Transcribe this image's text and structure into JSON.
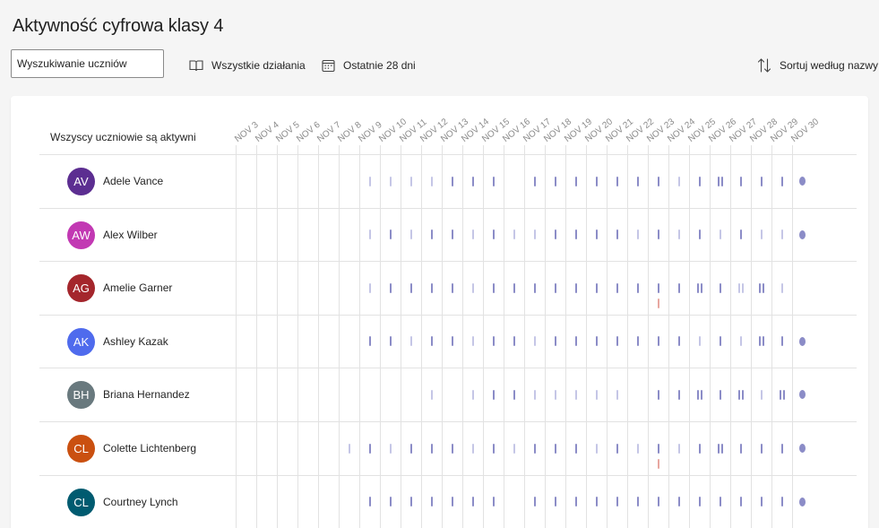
{
  "page": {
    "title": "Aktywność cyfrowa klasy 4"
  },
  "toolbar": {
    "search_placeholder": "Wyszukiwanie uczniów",
    "activity_filter": "Wszystkie działania",
    "range_filter": "Ostatnie 28 dni",
    "sort_label": "Sortuj według nazwy"
  },
  "grid": {
    "status_label": "Wszyscy uczniowie są aktywni",
    "days": [
      "NOV 3",
      "NOV 4",
      "NOV 5",
      "NOV 6",
      "NOV 7",
      "NOV 8",
      "NOV 9",
      "NOV 10",
      "NOV 11",
      "NOV 12",
      "NOV 13",
      "NOV 14",
      "NOV 15",
      "NOV 16",
      "NOV 17",
      "NOV 18",
      "NOV 19",
      "NOV 20",
      "NOV 21",
      "NOV 22",
      "NOV 23",
      "NOV 24",
      "NOV 25",
      "NOV 26",
      "NOV 27",
      "NOV 28",
      "NOV 29",
      "NOV 30"
    ]
  },
  "colors": {
    "activity": "#8b8cc7",
    "activity_light": "#c5c6e6",
    "alert": "#e8a7a0"
  },
  "students": [
    {
      "initials": "AV",
      "name": "Adele Vance",
      "avatar_color": "#5c2e91",
      "activity": [
        {
          "d": 6,
          "l": 1
        },
        {
          "d": 7,
          "l": 1
        },
        {
          "d": 8,
          "l": 1
        },
        {
          "d": 9,
          "l": 1
        },
        {
          "d": 10
        },
        {
          "d": 11
        },
        {
          "d": 12
        },
        {
          "d": 14
        },
        {
          "d": 15
        },
        {
          "d": 16
        },
        {
          "d": 17
        },
        {
          "d": 18
        },
        {
          "d": 19
        },
        {
          "d": 20
        },
        {
          "d": 21,
          "l": 1
        },
        {
          "d": 22
        },
        {
          "d": 23,
          "n": 2
        },
        {
          "d": 24
        },
        {
          "d": 25
        },
        {
          "d": 26
        },
        {
          "d": 27,
          "dot": 1
        }
      ]
    },
    {
      "initials": "AW",
      "name": "Alex Wilber",
      "avatar_color": "#c239b3",
      "activity": [
        {
          "d": 6,
          "l": 1
        },
        {
          "d": 7
        },
        {
          "d": 8,
          "l": 1
        },
        {
          "d": 9
        },
        {
          "d": 10
        },
        {
          "d": 11,
          "l": 1
        },
        {
          "d": 12
        },
        {
          "d": 13,
          "l": 1
        },
        {
          "d": 14,
          "l": 1
        },
        {
          "d": 15
        },
        {
          "d": 16
        },
        {
          "d": 17
        },
        {
          "d": 18
        },
        {
          "d": 19,
          "l": 1
        },
        {
          "d": 20
        },
        {
          "d": 21,
          "l": 1
        },
        {
          "d": 22
        },
        {
          "d": 23,
          "l": 1
        },
        {
          "d": 24
        },
        {
          "d": 25,
          "l": 1
        },
        {
          "d": 26,
          "l": 1
        },
        {
          "d": 27,
          "dot": 1
        }
      ]
    },
    {
      "initials": "AG",
      "name": "Amelie Garner",
      "avatar_color": "#a4262c",
      "activity": [
        {
          "d": 6,
          "l": 1
        },
        {
          "d": 7
        },
        {
          "d": 8
        },
        {
          "d": 9
        },
        {
          "d": 10
        },
        {
          "d": 11,
          "l": 1
        },
        {
          "d": 12
        },
        {
          "d": 13
        },
        {
          "d": 14
        },
        {
          "d": 15
        },
        {
          "d": 16
        },
        {
          "d": 17
        },
        {
          "d": 18
        },
        {
          "d": 19
        },
        {
          "d": 20,
          "alert": 1
        },
        {
          "d": 21
        },
        {
          "d": 22,
          "n": 2
        },
        {
          "d": 23
        },
        {
          "d": 24,
          "n": 2,
          "l": 1
        },
        {
          "d": 25,
          "n": 2
        },
        {
          "d": 26,
          "l": 1
        }
      ]
    },
    {
      "initials": "AK",
      "name": "Ashley Kazak",
      "avatar_color": "#4f6bed",
      "activity": [
        {
          "d": 6
        },
        {
          "d": 7
        },
        {
          "d": 8,
          "l": 1
        },
        {
          "d": 9
        },
        {
          "d": 10
        },
        {
          "d": 11,
          "l": 1
        },
        {
          "d": 12
        },
        {
          "d": 13
        },
        {
          "d": 14,
          "l": 1
        },
        {
          "d": 15
        },
        {
          "d": 16
        },
        {
          "d": 17
        },
        {
          "d": 18
        },
        {
          "d": 19
        },
        {
          "d": 20
        },
        {
          "d": 21
        },
        {
          "d": 22,
          "l": 1
        },
        {
          "d": 23
        },
        {
          "d": 24,
          "l": 1
        },
        {
          "d": 25,
          "n": 2
        },
        {
          "d": 26
        },
        {
          "d": 27,
          "dot": 1
        }
      ]
    },
    {
      "initials": "BH",
      "name": "Briana Hernandez",
      "avatar_color": "#69797e",
      "activity": [
        {
          "d": 9,
          "l": 1
        },
        {
          "d": 11,
          "l": 1
        },
        {
          "d": 12
        },
        {
          "d": 13
        },
        {
          "d": 14,
          "l": 1
        },
        {
          "d": 15,
          "l": 1
        },
        {
          "d": 16,
          "l": 1
        },
        {
          "d": 17,
          "l": 1
        },
        {
          "d": 18,
          "l": 1
        },
        {
          "d": 20
        },
        {
          "d": 21
        },
        {
          "d": 22,
          "n": 2
        },
        {
          "d": 23
        },
        {
          "d": 24,
          "n": 2
        },
        {
          "d": 25,
          "l": 1
        },
        {
          "d": 26,
          "n": 2
        },
        {
          "d": 27,
          "dot": 1
        }
      ]
    },
    {
      "initials": "CL",
      "name": "Colette Lichtenberg",
      "avatar_color": "#ca5010",
      "activity": [
        {
          "d": 5,
          "l": 1
        },
        {
          "d": 6
        },
        {
          "d": 7,
          "l": 1
        },
        {
          "d": 8
        },
        {
          "d": 9
        },
        {
          "d": 10
        },
        {
          "d": 11,
          "l": 1
        },
        {
          "d": 12
        },
        {
          "d": 13,
          "l": 1
        },
        {
          "d": 14
        },
        {
          "d": 15
        },
        {
          "d": 16
        },
        {
          "d": 17,
          "l": 1
        },
        {
          "d": 18
        },
        {
          "d": 19,
          "l": 1
        },
        {
          "d": 20,
          "alert": 1
        },
        {
          "d": 21,
          "l": 1
        },
        {
          "d": 22
        },
        {
          "d": 23,
          "n": 2
        },
        {
          "d": 24
        },
        {
          "d": 25
        },
        {
          "d": 26
        },
        {
          "d": 27,
          "dot": 1
        }
      ]
    },
    {
      "initials": "CL",
      "name": "Courtney Lynch",
      "avatar_color": "#005b70",
      "activity": [
        {
          "d": 6
        },
        {
          "d": 7
        },
        {
          "d": 8
        },
        {
          "d": 9
        },
        {
          "d": 10
        },
        {
          "d": 11
        },
        {
          "d": 12
        },
        {
          "d": 14
        },
        {
          "d": 15
        },
        {
          "d": 16
        },
        {
          "d": 17
        },
        {
          "d": 18
        },
        {
          "d": 19
        },
        {
          "d": 20
        },
        {
          "d": 21
        },
        {
          "d": 22
        },
        {
          "d": 23
        },
        {
          "d": 24
        },
        {
          "d": 25
        },
        {
          "d": 26
        },
        {
          "d": 27,
          "dot": 1
        }
      ]
    }
  ]
}
